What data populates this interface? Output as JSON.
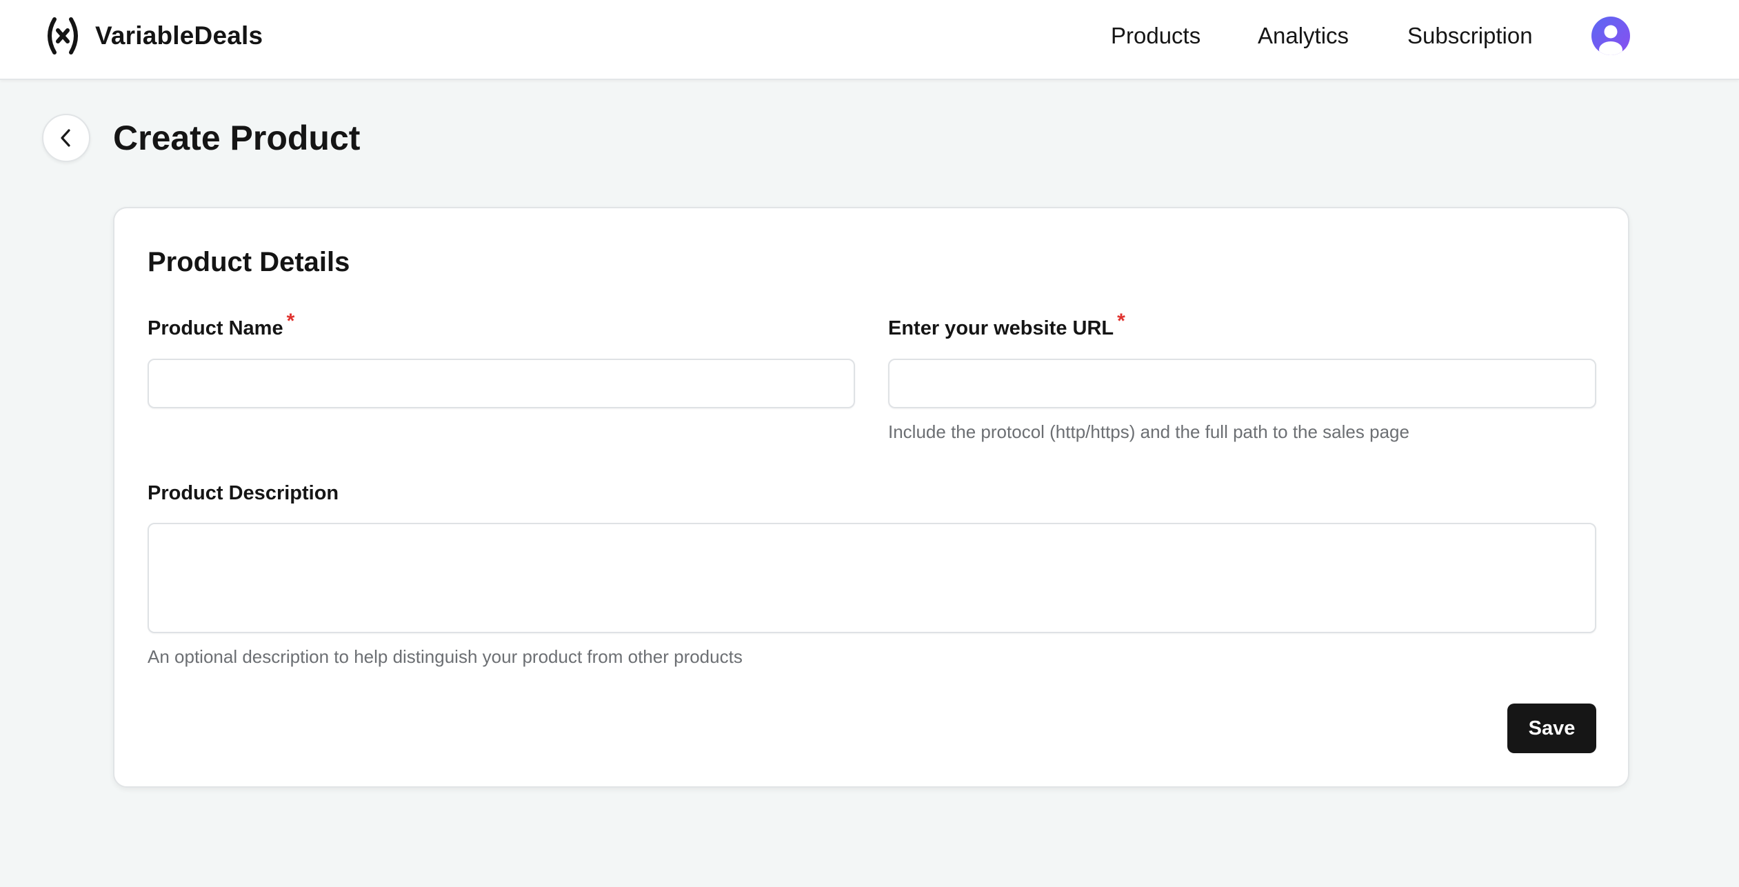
{
  "header": {
    "brand_name": "VariableDeals",
    "logo_icon": "variable-x-logo-icon",
    "nav": [
      {
        "label": "Products"
      },
      {
        "label": "Analytics"
      },
      {
        "label": "Subscription"
      }
    ],
    "avatar_icon": "user-avatar-icon"
  },
  "page": {
    "back_icon": "chevron-left-icon",
    "title": "Create Product"
  },
  "form": {
    "section_title": "Product Details",
    "product_name": {
      "label": "Product Name",
      "required_mark": "*",
      "value": "",
      "placeholder": ""
    },
    "website_url": {
      "label": "Enter your website URL",
      "required_mark": "*",
      "value": "",
      "placeholder": "",
      "help": "Include the protocol (http/https) and the full path to the sales page"
    },
    "description": {
      "label": "Product Description",
      "value": "",
      "placeholder": "",
      "help": "An optional description to help distinguish your product from other products"
    },
    "save_label": "Save"
  },
  "colors": {
    "page_background": "#f3f6f6",
    "card_background": "#ffffff",
    "required_mark": "#e0332f",
    "primary_button": "#161616",
    "avatar_gradient_start": "#5b68f2",
    "avatar_gradient_end": "#8a4ff0"
  }
}
